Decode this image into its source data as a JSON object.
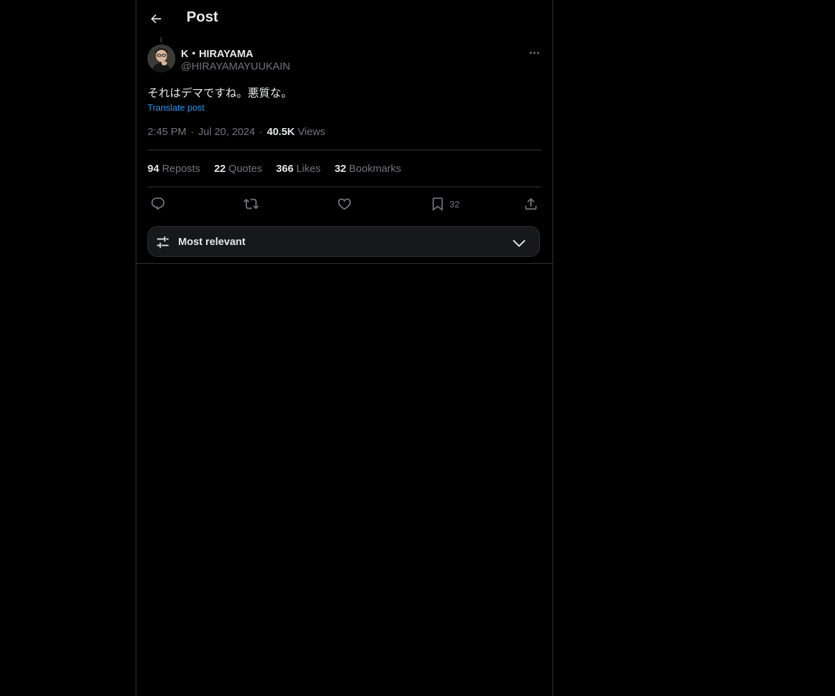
{
  "header": {
    "title": "Post",
    "back_icon": "arrow-left-icon"
  },
  "post": {
    "author_name": "K・HIRAYAMA",
    "author_handle": "@HIRAYAMAYUUKAIN",
    "text": "それはデマですね。悪質な。",
    "translate_label": "Translate post",
    "time": "2:45 PM",
    "date": "Jul 20, 2024",
    "views_count": "40.5K",
    "views_label": "Views",
    "more_icon": "ellipsis-icon"
  },
  "stats": {
    "reposts_count": "94",
    "reposts_label": "Reposts",
    "quotes_count": "22",
    "quotes_label": "Quotes",
    "likes_count": "366",
    "likes_label": "Likes",
    "bookmarks_count": "32",
    "bookmarks_label": "Bookmarks"
  },
  "actions": {
    "reply_icon": "reply-icon",
    "repost_icon": "repost-icon",
    "like_icon": "heart-icon",
    "bookmark_icon": "bookmark-icon",
    "bookmark_count": "32",
    "share_icon": "share-icon"
  },
  "sort": {
    "label": "Most relevant",
    "icon": "sliders-icon",
    "chevron": "chevron-down-icon"
  },
  "colors": {
    "background": "#000000",
    "border": "#2f3336",
    "text_primary": "#e7e9ea",
    "text_secondary": "#71767b",
    "link": "#1d9bf0"
  }
}
